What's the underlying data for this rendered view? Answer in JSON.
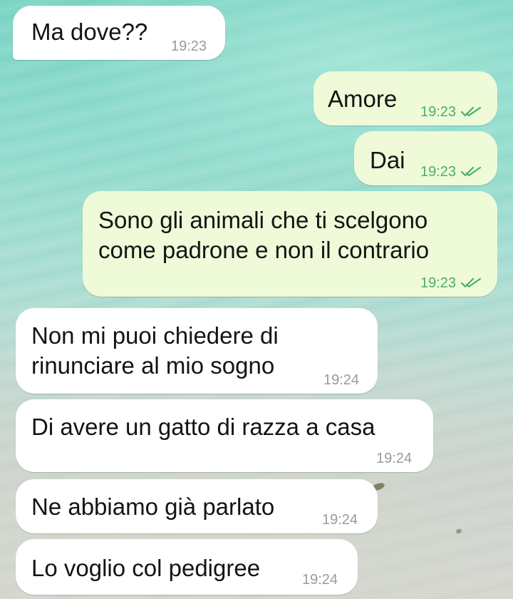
{
  "messages": [
    {
      "direction": "in",
      "text": "Ma dove??",
      "time": "19:23"
    },
    {
      "direction": "out",
      "text": "Amore",
      "time": "19:23",
      "status": "double-check-icon"
    },
    {
      "direction": "out",
      "text": "Dai",
      "time": "19:23",
      "status": "double-check-icon"
    },
    {
      "direction": "out",
      "text": "Sono gli animali che ti scelgono\ncome padrone e non il contrario",
      "time": "19:23",
      "status": "double-check-icon"
    },
    {
      "direction": "in",
      "text": "Non mi puoi chiedere di\nrinunciare al mio sogno",
      "time": "19:24"
    },
    {
      "direction": "in",
      "text": "Di avere un gatto di razza a casa",
      "time": "19:24"
    },
    {
      "direction": "in",
      "text": "Ne abbiamo già parlato",
      "time": "19:24"
    },
    {
      "direction": "in",
      "text": "Lo voglio col pedigree",
      "time": "19:24"
    }
  ],
  "colors": {
    "incoming_bubble": "#ffffff",
    "outgoing_bubble": "#eefad8",
    "read_receipt": "#4fae6a",
    "timestamp": "#9a9a9a"
  }
}
